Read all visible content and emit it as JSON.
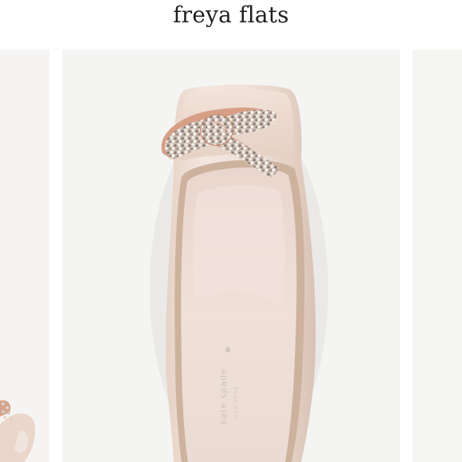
{
  "listing": {
    "title": "freya flats"
  },
  "product_image": {
    "brand_mark": "kate spade",
    "brand_city": "NEW YORK"
  },
  "colors": {
    "background": "#ffffff",
    "photo_background": "#f4f4f3",
    "satin": "#eddcd2",
    "insole": "#ebd9d1",
    "binding": "#cdb29d",
    "bow_base": "#d79f86"
  }
}
